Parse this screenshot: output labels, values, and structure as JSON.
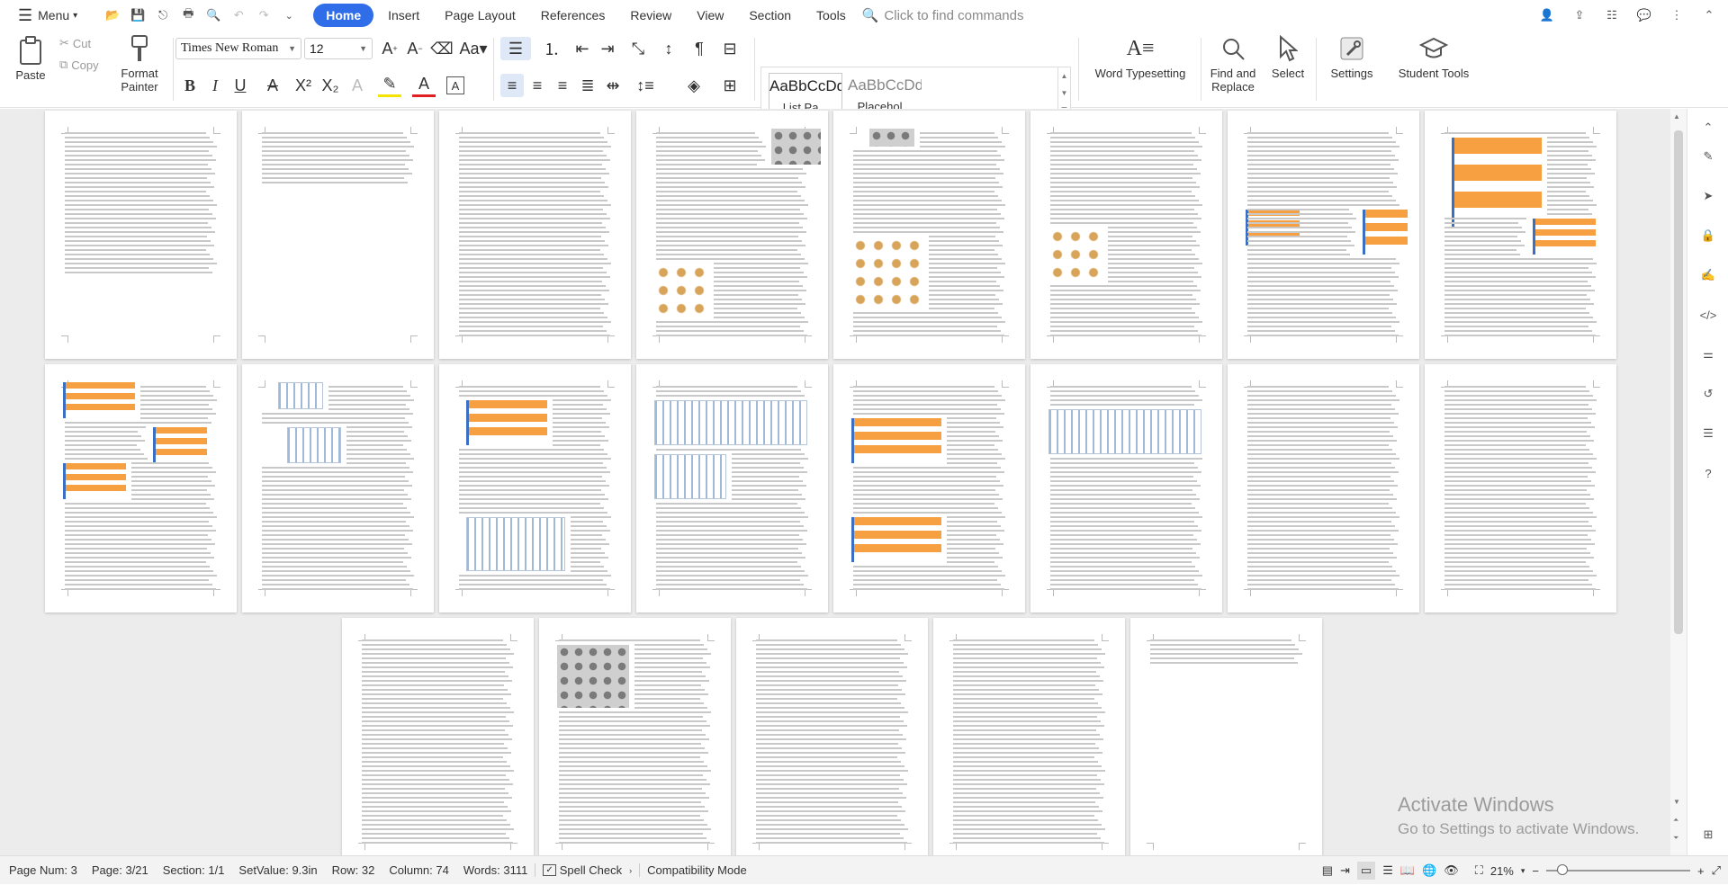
{
  "menu": {
    "label": "Menu"
  },
  "tabs": [
    {
      "label": "Home"
    },
    {
      "label": "Insert"
    },
    {
      "label": "Page Layout"
    },
    {
      "label": "References"
    },
    {
      "label": "Review"
    },
    {
      "label": "View"
    },
    {
      "label": "Section"
    },
    {
      "label": "Tools"
    }
  ],
  "search": {
    "placeholder": "Click to find commands"
  },
  "ribbon": {
    "paste": "Paste",
    "cut": "Cut",
    "copy": "Copy",
    "format_painter": "Format Painter",
    "font_name": "Times New Roman",
    "font_size": "12",
    "style1_sample": "AaBbCcDd",
    "style1_label": "List Pa...",
    "style2_sample": "AaBbCcDd",
    "style2_label": "Placehol...",
    "word_typesetting": "Word Typesetting",
    "find_replace": "Find and Replace",
    "select": "Select",
    "settings": "Settings",
    "student_tools": "Student Tools"
  },
  "watermark": {
    "line1": "Activate Windows",
    "line2": "Go to Settings to activate Windows."
  },
  "status": {
    "page_num": "Page Num: 3",
    "page": "Page: 3/21",
    "section": "Section: 1/1",
    "setvalue": "SetValue: 9.3in",
    "row": "Row: 32",
    "column": "Column: 74",
    "words": "Words: 3111",
    "spell_check": "Spell Check",
    "compat": "Compatibility Mode",
    "zoom": "21%"
  },
  "colors": {
    "accent": "#2f6ee8",
    "image_orange": "#f7a042"
  }
}
